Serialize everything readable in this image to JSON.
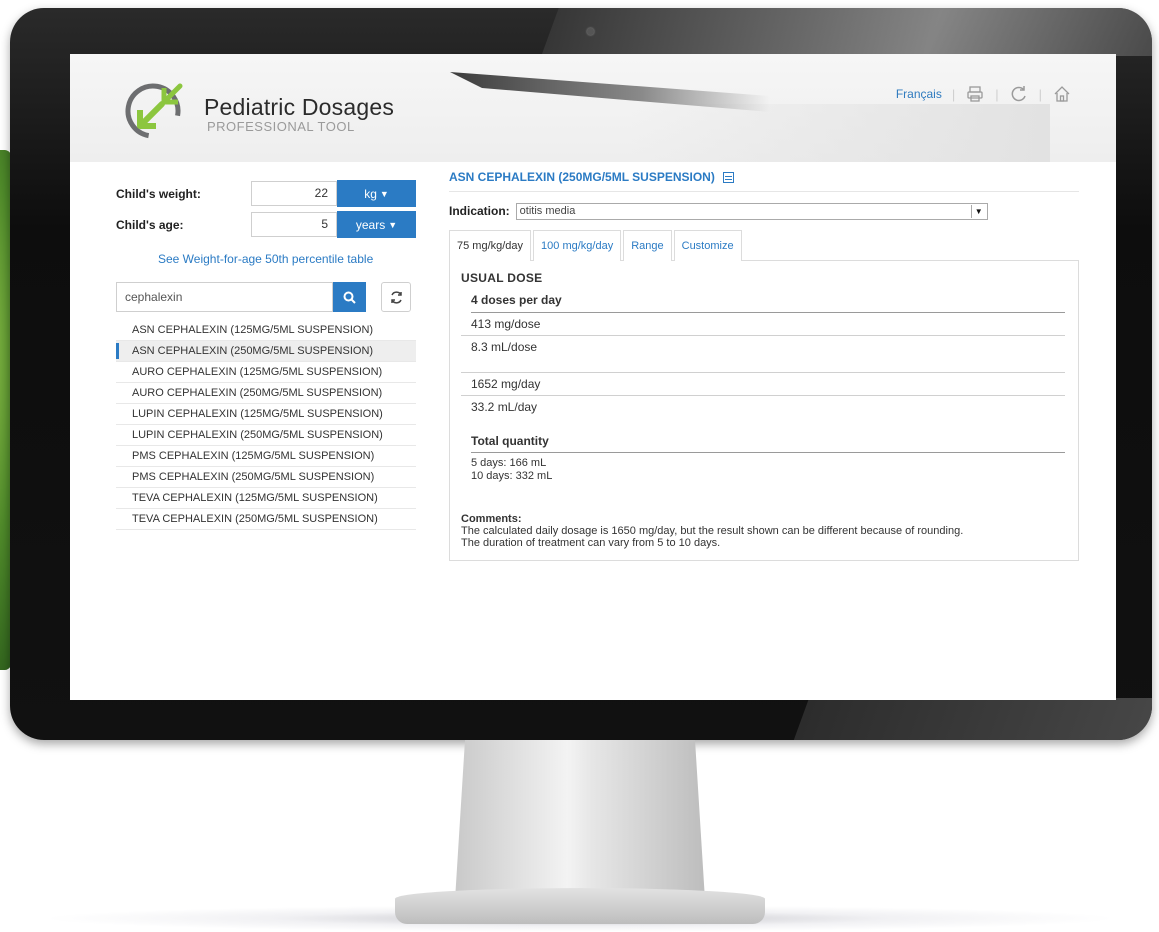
{
  "app": {
    "title": "Pediatric Dosages",
    "subtitle": "PROFESSIONAL TOOL"
  },
  "header": {
    "language_link": "Français",
    "icons": [
      "print-icon",
      "refresh-icon",
      "home-icon"
    ]
  },
  "patient": {
    "weight_label": "Child's weight:",
    "weight_value": "22",
    "weight_unit": "kg",
    "age_label": "Child's age:",
    "age_value": "5",
    "age_unit": "years",
    "percentile_link": "See Weight-for-age 50th percentile table"
  },
  "search": {
    "value": "cephalexin"
  },
  "medications": [
    "ASN CEPHALEXIN (125MG/5ML SUSPENSION)",
    "ASN CEPHALEXIN (250MG/5ML SUSPENSION)",
    "AURO CEPHALEXIN (125MG/5ML SUSPENSION)",
    "AURO CEPHALEXIN (250MG/5ML SUSPENSION)",
    "LUPIN CEPHALEXIN (125MG/5ML SUSPENSION)",
    "LUPIN CEPHALEXIN (250MG/5ML SUSPENSION)",
    "PMS CEPHALEXIN (125MG/5ML SUSPENSION)",
    "PMS CEPHALEXIN (250MG/5ML SUSPENSION)",
    "TEVA CEPHALEXIN (125MG/5ML SUSPENSION)",
    "TEVA CEPHALEXIN (250MG/5ML SUSPENSION)"
  ],
  "selected_medication_index": 1,
  "detail": {
    "drug_title": "ASN CEPHALEXIN (250MG/5ML SUSPENSION)",
    "indication_label": "Indication:",
    "indication_value": "otitis media",
    "tabs": [
      "75 mg/kg/day",
      "100 mg/kg/day",
      "Range",
      "Customize"
    ],
    "active_tab": 0,
    "usual_dose_heading": "USUAL DOSE",
    "doses_per_day": "4 doses per day",
    "mg_per_dose": "413 mg/dose",
    "ml_per_dose": "8.3 mL/dose",
    "mg_per_day": "1652 mg/day",
    "ml_per_day": "33.2 mL/day",
    "total_heading": "Total quantity",
    "total_5_days": "5 days: 166 mL",
    "total_10_days": "10 days: 332 mL",
    "comments_label": "Comments:",
    "comment_line_1": "The calculated daily dosage is 1650 mg/day, but the result shown can be different because of rounding.",
    "comment_line_2": "The duration of treatment can vary from 5 to 10 days."
  },
  "colors": {
    "accent": "#2b7bc4",
    "logo_green": "#8cc63f",
    "logo_gray": "#6d6e70"
  }
}
